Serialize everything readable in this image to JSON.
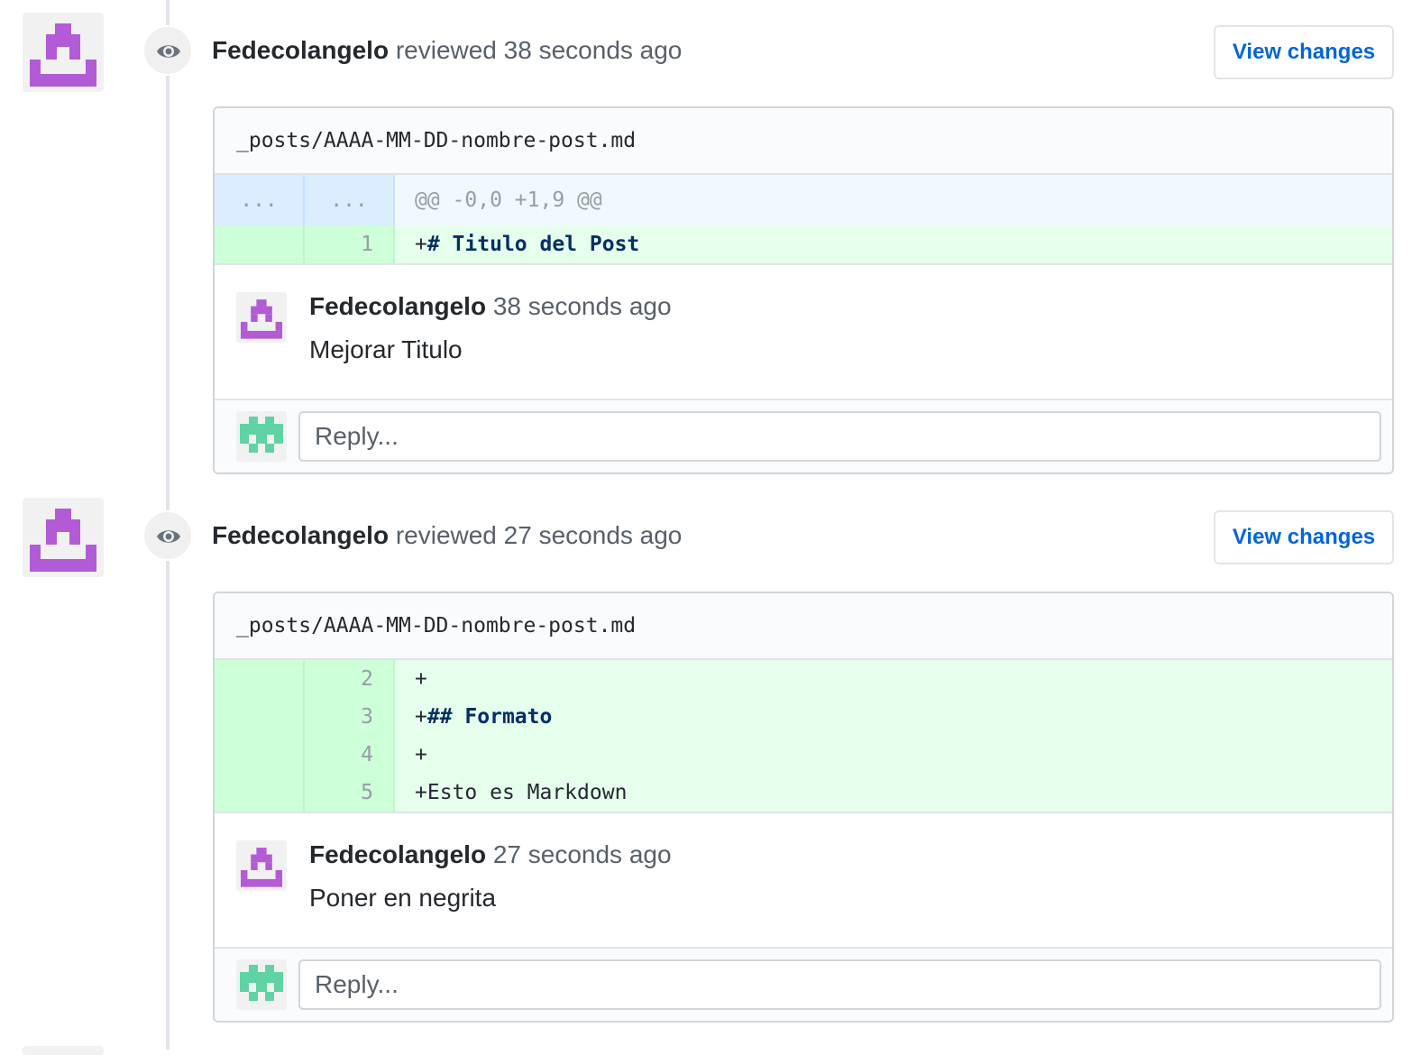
{
  "reviews": [
    {
      "author": "Fedecolangelo",
      "action": "reviewed",
      "time": "38 seconds ago",
      "view_changes_label": "View changes",
      "file_path": "_posts/AAAA-MM-DD-nombre-post.md",
      "diff": {
        "hunk": {
          "old": "...",
          "new": "...",
          "text": "@@ -0,0 +1,9 @@"
        },
        "lines": [
          {
            "new_num": "1",
            "prefix": "+",
            "text": "# Titulo del Post",
            "heading": true
          }
        ]
      },
      "comment": {
        "author": "Fedecolangelo",
        "time": "38 seconds ago",
        "body": "Mejorar Titulo"
      },
      "reply_placeholder": "Reply..."
    },
    {
      "author": "Fedecolangelo",
      "action": "reviewed",
      "time": "27 seconds ago",
      "view_changes_label": "View changes",
      "file_path": "_posts/AAAA-MM-DD-nombre-post.md",
      "diff": {
        "lines": [
          {
            "new_num": "2",
            "prefix": "+",
            "text": ""
          },
          {
            "new_num": "3",
            "prefix": "+",
            "text": "## Formato",
            "heading": true
          },
          {
            "new_num": "4",
            "prefix": "+",
            "text": ""
          },
          {
            "new_num": "5",
            "prefix": "+",
            "text": "Esto es Markdown"
          }
        ]
      },
      "comment": {
        "author": "Fedecolangelo",
        "time": "27 seconds ago",
        "body": "Poner en negrita"
      },
      "reply_placeholder": "Reply..."
    }
  ],
  "colors": {
    "reviewer_avatar": "#b35ad6",
    "current_user_avatar": "#5fd3a3",
    "link": "#0366d6",
    "addition_bg": "#e6ffed",
    "hunk_bg": "#f1f8ff"
  },
  "icons": {
    "review_badge": "eye-icon"
  }
}
